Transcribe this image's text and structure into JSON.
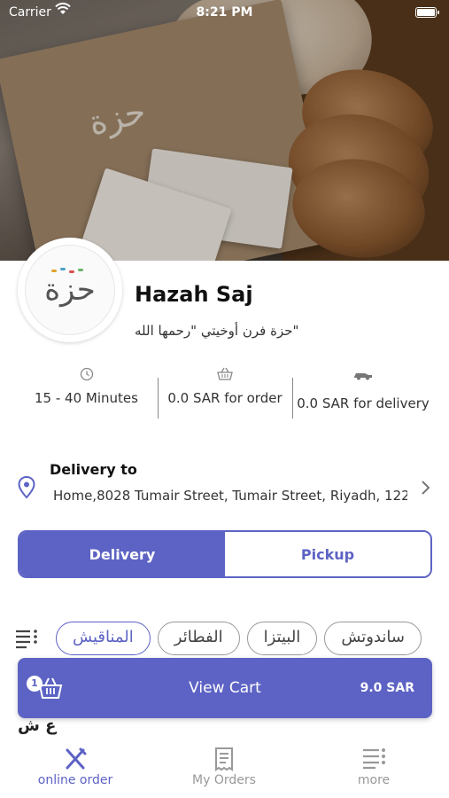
{
  "status_bar": {
    "carrier": "Carrier",
    "time": "8:21 PM"
  },
  "hero": {
    "logo_text": "حزة"
  },
  "restaurant": {
    "logo_text": "حزة",
    "name": "Hazah Saj",
    "subtitle": "حزة فرن أوخيتي \"رحمها الله\""
  },
  "stats": {
    "time": "15 - 40 Minutes",
    "min_order": "0.0 SAR for order",
    "delivery_fee": "0.0 SAR for delivery"
  },
  "delivery": {
    "title": "Delivery to",
    "address": "Home,8028 Tumair Street, Tumair Street, Riyadh, 122..."
  },
  "order_type": {
    "delivery": "Delivery",
    "pickup": "Pickup",
    "selected": "Delivery"
  },
  "categories": [
    {
      "label": "المناقيش",
      "active": true
    },
    {
      "label": "الفطائر",
      "active": false
    },
    {
      "label": "البيتزا",
      "active": false
    },
    {
      "label": "ساندوتش",
      "active": false
    }
  ],
  "cart": {
    "count": "1",
    "label": "View Cart",
    "total": "9.0 SAR"
  },
  "content_peek": "ع ش",
  "tabs": [
    {
      "label": "online order",
      "icon": "fork-knife-icon",
      "active": true
    },
    {
      "label": "My Orders",
      "icon": "receipt-icon",
      "active": false
    },
    {
      "label": "more",
      "icon": "menu-list-icon",
      "active": false
    }
  ],
  "colors": {
    "accent": "#5d63c4",
    "muted": "#999999"
  }
}
